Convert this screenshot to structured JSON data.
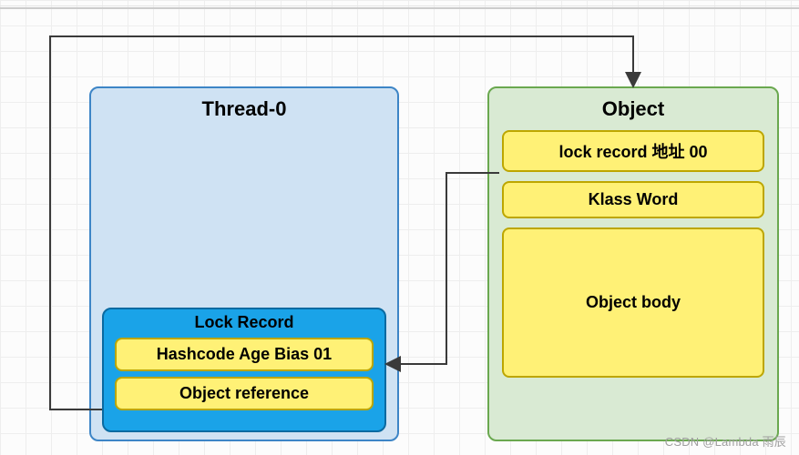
{
  "thread": {
    "title": "Thread-0",
    "lock_record": {
      "title": "Lock Record",
      "hashcode": "Hashcode Age Bias 01",
      "object_ref": "Object reference"
    }
  },
  "object": {
    "title": "Object",
    "mark_word": "lock record 地址 00",
    "klass_word": "Klass Word",
    "body": "Object body"
  },
  "watermark": "CSDN @Lambda   雨辰"
}
